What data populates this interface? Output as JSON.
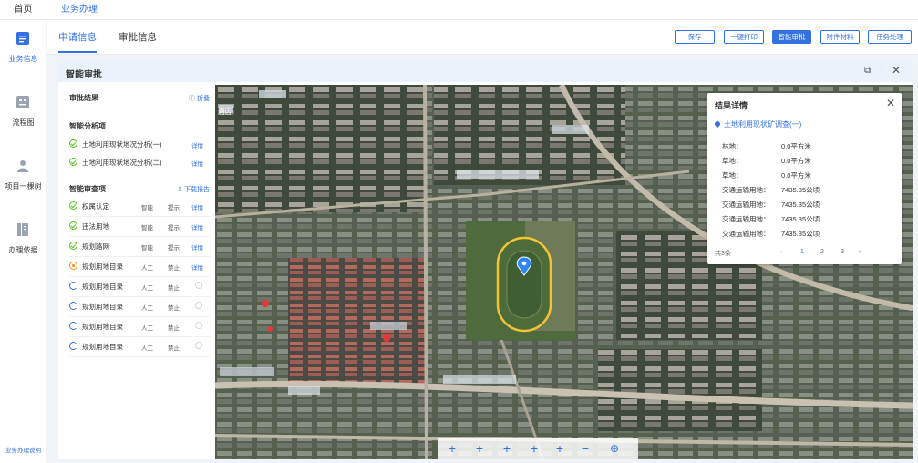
{
  "topbar": {
    "home": "首页",
    "crumb": "业务办理"
  },
  "sidebar": {
    "items": [
      {
        "label": "业务信息"
      },
      {
        "label": "流程图"
      },
      {
        "label": "项目一棵树"
      },
      {
        "label": "办理依据"
      }
    ],
    "footer": "业务办理说明"
  },
  "tabs": [
    {
      "label": "申请信息"
    },
    {
      "label": "审批信息"
    }
  ],
  "toolbar": {
    "save": "保存",
    "print": "一键打印",
    "smart": "智能审批",
    "attach": "附件材料",
    "task": "任务处理"
  },
  "panel": {
    "title": "智能审批",
    "result_title": "审批结果",
    "fold": "折叠",
    "analysis_title": "智能分析项",
    "analysis": [
      {
        "name": "土地利用现状地况分析(一)",
        "link": "详情"
      },
      {
        "name": "土地利用现状地况分析(二)",
        "link": "详情"
      }
    ],
    "review_title": "智能审查项",
    "download": "下载报告",
    "review": [
      {
        "name": "权属认定",
        "c1": "智能",
        "c2": "提示",
        "link": "详情",
        "status": "ok"
      },
      {
        "name": "违法用地",
        "c1": "智能",
        "c2": "提示",
        "link": "详情",
        "status": "ok"
      },
      {
        "name": "规划路网",
        "c1": "智能",
        "c2": "提示",
        "link": "详情",
        "status": "ok"
      },
      {
        "name": "规划用地目录",
        "c1": "人工",
        "c2": "禁止",
        "link": "详情",
        "status": "warn"
      },
      {
        "name": "规划用地目录",
        "c1": "人工",
        "c2": "禁止",
        "link": "",
        "status": "pending"
      },
      {
        "name": "规划用地目录",
        "c1": "人工",
        "c2": "禁止",
        "link": "",
        "status": "pending"
      },
      {
        "name": "规划用地目录",
        "c1": "人工",
        "c2": "禁止",
        "link": "",
        "status": "pending"
      },
      {
        "name": "规划用地目录",
        "c1": "人工",
        "c2": "禁止",
        "link": "",
        "status": "pending"
      }
    ]
  },
  "map": {
    "label": "酒店",
    "tools": [
      "+",
      "+",
      "+",
      "+",
      "+",
      "−",
      "⊕"
    ]
  },
  "popup": {
    "title": "结果详情",
    "subtitle": "土地利用现状矿调查(一)",
    "rows": [
      {
        "k": "林地：",
        "v": "0.0平方米"
      },
      {
        "k": "草地：",
        "v": "0.0平方米"
      },
      {
        "k": "草地：",
        "v": "0.0平方米"
      },
      {
        "k": "交通运输用地：",
        "v": "7435.35公顷"
      },
      {
        "k": "交通运输用地：",
        "v": "7435.35公顷"
      },
      {
        "k": "交通运输用地：",
        "v": "7435.35公顷"
      },
      {
        "k": "交通运输用地：",
        "v": "7435.35公顷"
      }
    ],
    "pager": {
      "total": "共3条",
      "prev": "‹",
      "p1": "1",
      "p2": "2",
      "p3": "3",
      "next": "›"
    }
  }
}
